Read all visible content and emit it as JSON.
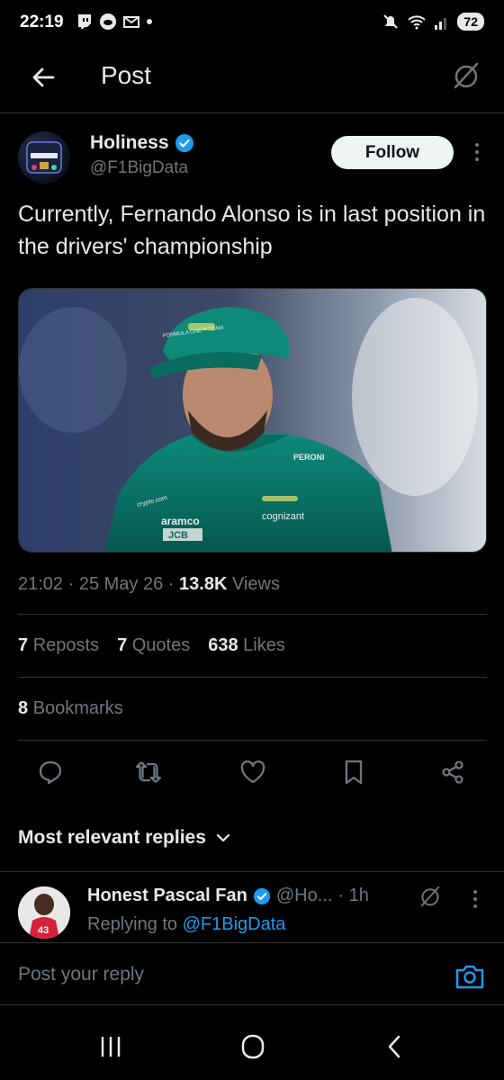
{
  "status": {
    "time": "22:19",
    "battery": "72",
    "left_icons": [
      "twitch-icon",
      "discord-icon",
      "gmail-icon",
      "dot-icon"
    ],
    "right_icons": [
      "mute-icon",
      "wifi-icon",
      "signal-icon"
    ]
  },
  "header": {
    "title": "Post",
    "back_icon": "arrow-left-icon",
    "grok_icon": "grok-icon"
  },
  "post": {
    "author_name": "Holiness",
    "verified": true,
    "author_handle": "@F1BigData",
    "follow_label": "Follow",
    "text": "Currently, Fernando Alonso is in last position in the drivers' championship",
    "media": {
      "cap_brand": "FORMULA ONE™ TEAM",
      "sponsor_1": "aramco",
      "sponsor_2": "cognizant",
      "sponsor_3": "PERONI",
      "sponsor_4": "JCB",
      "sponsor_5": "crypto.com"
    },
    "time": "21:02",
    "date": "25 May 26",
    "views_count": "13.8K",
    "views_label": "Views",
    "reposts_count": "7",
    "reposts_label": "Reposts",
    "quotes_count": "7",
    "quotes_label": "Quotes",
    "likes_count": "638",
    "likes_label": "Likes",
    "bookmarks_count": "8",
    "bookmarks_label": "Bookmarks"
  },
  "actions": [
    "reply-icon",
    "repost-icon",
    "like-icon",
    "bookmark-icon",
    "share-icon"
  ],
  "replies": {
    "sort_label": "Most relevant replies",
    "items": [
      {
        "name": "Honest Pascal Fan",
        "verified": true,
        "handle": "@Ho...",
        "time": "· 1h",
        "replying_prefix": "Replying to",
        "replying_to": "@F1BigData",
        "jersey_number": "43"
      }
    ]
  },
  "composer": {
    "placeholder": "Post your reply"
  },
  "colors": {
    "background": "#000000",
    "text": "#e7e9ea",
    "muted": "#71767b",
    "accent": "#1d9bf0",
    "divider": "#2f3336"
  }
}
